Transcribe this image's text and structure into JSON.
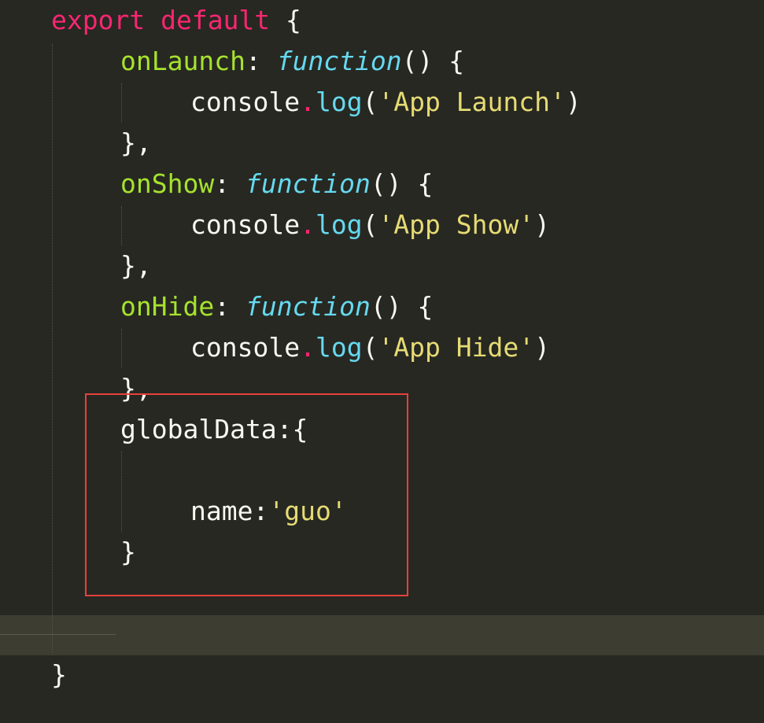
{
  "code": {
    "line1": {
      "keyword1": "export",
      "keyword2": "default",
      "brace": "{"
    },
    "line2": {
      "property": "onLaunch",
      "colon": ":",
      "keyword": "function",
      "rest": "() {"
    },
    "line3": {
      "object": "console",
      "dot": ".",
      "method": "log",
      "open": "(",
      "string": "'App Launch'",
      "close": ")"
    },
    "line4": {
      "text": "},"
    },
    "line5": {
      "property": "onShow",
      "colon": ":",
      "keyword": "function",
      "rest": "() {"
    },
    "line6": {
      "object": "console",
      "dot": ".",
      "method": "log",
      "open": "(",
      "string": "'App Show'",
      "close": ")"
    },
    "line7": {
      "text": "},"
    },
    "line8": {
      "property": "onHide",
      "colon": ":",
      "keyword": "function",
      "rest": "() {"
    },
    "line9": {
      "object": "console",
      "dot": ".",
      "method": "log",
      "open": "(",
      "string": "'App Hide'",
      "close": ")"
    },
    "line10": {
      "text": "},"
    },
    "line11": {
      "text": "globalData:{"
    },
    "line13": {
      "key": "name:",
      "string": "'guo'"
    },
    "line14": {
      "text": "}"
    },
    "line17": {
      "text": "}"
    }
  },
  "colors": {
    "background": "#272822",
    "keyword": "#f92672",
    "property": "#a6e22e",
    "function_keyword": "#66d9ef",
    "string": "#e6db74",
    "default_text": "#f8f8f2",
    "highlight_box": "#e8413c",
    "current_line": "#3e3d32"
  }
}
